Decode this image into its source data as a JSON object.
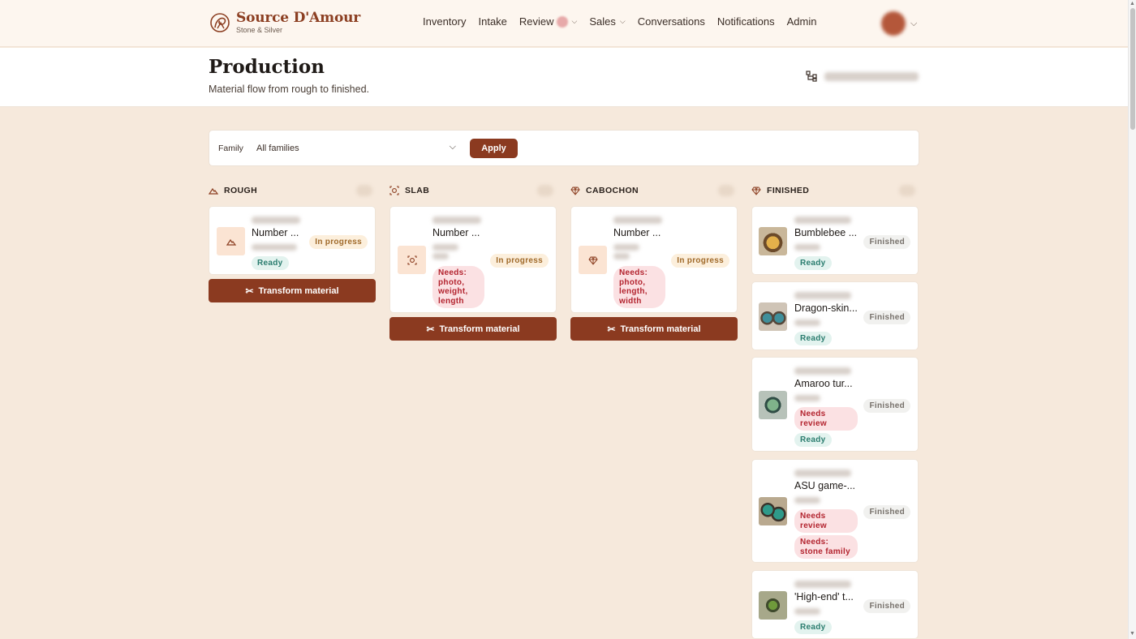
{
  "brand": {
    "name": "Source D'Amour",
    "tagline": "Stone & Silver"
  },
  "nav": {
    "items": [
      {
        "label": "Inventory"
      },
      {
        "label": "Intake"
      },
      {
        "label": "Review"
      },
      {
        "label": "Sales"
      },
      {
        "label": "Conversations"
      },
      {
        "label": "Notifications"
      },
      {
        "label": "Admin"
      }
    ]
  },
  "page": {
    "title": "Production",
    "subtitle": "Material flow from rough to finished."
  },
  "filter": {
    "label": "Family",
    "selected": "All families",
    "apply_label": "Apply"
  },
  "columns": [
    {
      "title": "ROUGH",
      "icon": "mountain-icon",
      "cards": [
        {
          "title": "Number ...",
          "status": "In progress",
          "pills": [
            "Ready"
          ]
        }
      ],
      "action": "Transform material"
    },
    {
      "title": "SLAB",
      "icon": "slab-icon",
      "cards": [
        {
          "title": "Number ...",
          "status": "In progress",
          "pills": [
            "Needs: photo, weight, length"
          ]
        }
      ],
      "action": "Transform material"
    },
    {
      "title": "CABOCHON",
      "icon": "gem-icon",
      "cards": [
        {
          "title": "Number ...",
          "status": "In progress",
          "pills": [
            "Needs: photo, length, width"
          ]
        }
      ],
      "action": "Transform material"
    },
    {
      "title": "FINISHED",
      "icon": "gem-icon",
      "cards": [
        {
          "title": "Bumblebee ...",
          "status": "Finished",
          "pills": [
            "Ready"
          ]
        },
        {
          "title": "Dragon-skin...",
          "status": "Finished",
          "pills": [
            "Ready"
          ]
        },
        {
          "title": "Amaroo tur...",
          "status": "Finished",
          "pills": [
            "Needs review",
            "Ready"
          ]
        },
        {
          "title": "ASU game-...",
          "status": "Finished",
          "pills": [
            "Needs review",
            "Needs: stone family"
          ]
        },
        {
          "title": "'High-end' t...",
          "status": "Finished",
          "pills": [
            "Ready"
          ]
        }
      ]
    }
  ],
  "colors": {
    "accent": "#8b3a20",
    "background": "#f6e9dc",
    "ready": "#2b7d6f",
    "needs": "#b3242f",
    "in_progress": "#a06a2a"
  }
}
